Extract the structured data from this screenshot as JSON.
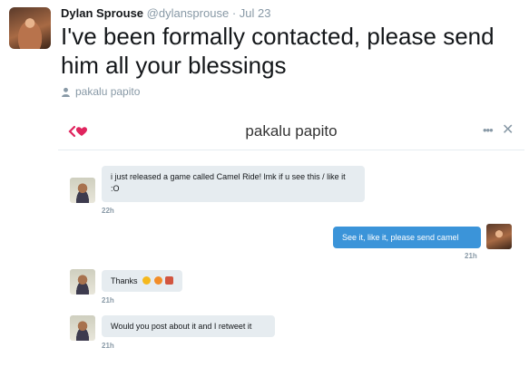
{
  "tweet": {
    "author_name": "Dylan Sprouse",
    "author_handle": "@dylansprouse",
    "separator": "·",
    "date": "Jul 23",
    "text": "I've been formally contacted, please send him all your blessings",
    "location_label": "pakalu papito"
  },
  "dm": {
    "title": "pakalu papito",
    "more_glyph": "•••",
    "close_glyph": "✕",
    "messages": [
      {
        "text": "i just released a game called Camel Ride! lmk if u see this / like it :O",
        "time": "22h"
      },
      {
        "text": "See it, like it, please send camel",
        "time": "21h"
      },
      {
        "text": "Thanks",
        "time": "21h"
      },
      {
        "text": "Would you post about it and I retweet it",
        "time": "21h"
      }
    ]
  },
  "colors": {
    "accent": "#3b94d9",
    "brand_red": "#e0245e",
    "muted": "#8899a6",
    "bubble_in": "#e6ecf0"
  }
}
